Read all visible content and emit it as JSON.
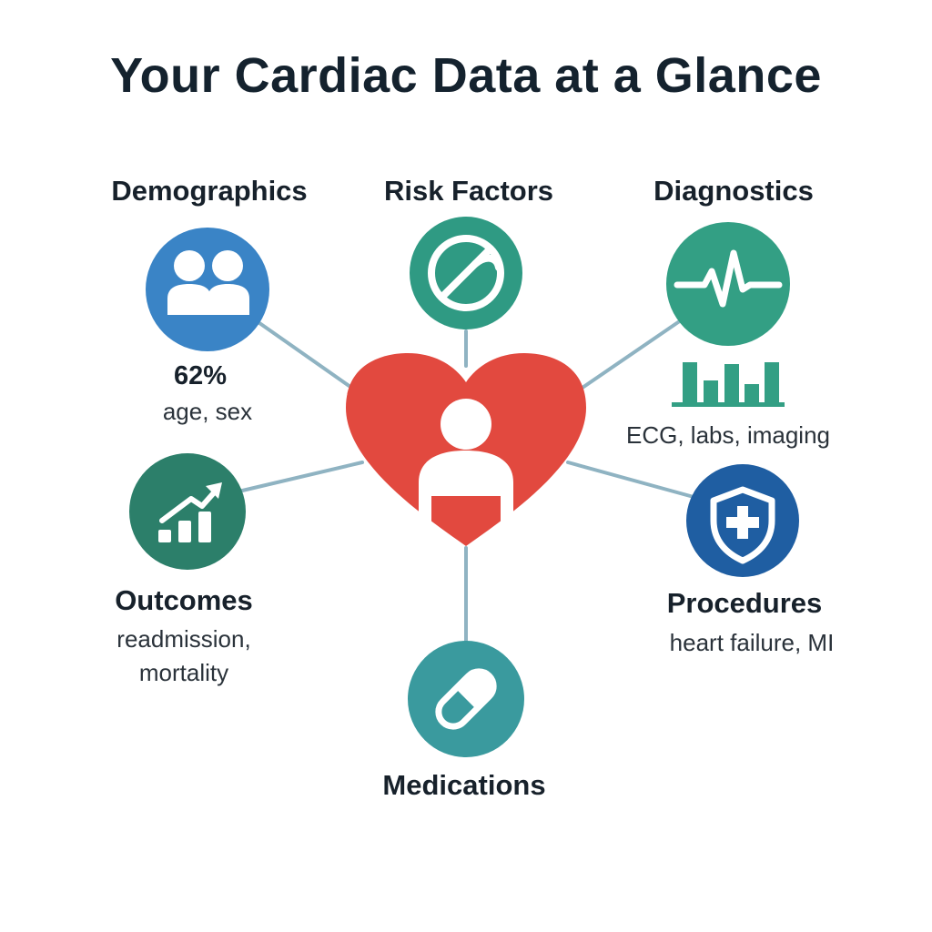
{
  "title": "Your Cardiac Data at a Glance",
  "nodes": {
    "demographics": {
      "label": "Demographics",
      "stat": "62%",
      "detail": "age, sex",
      "color": "#3a84c6",
      "icon": "people-icon"
    },
    "risk_factors": {
      "label": "Risk Factors",
      "color": "#2f9a83",
      "icon": "no-smoking-icon"
    },
    "diagnostics": {
      "label": "Diagnostics",
      "detail": "ECG, labs, imaging",
      "color": "#339f84",
      "icon": "ecg-wave-icon",
      "chart_icon": "bar-chart-icon"
    },
    "outcomes": {
      "label": "Outcomes",
      "detail_lines": [
        "readmission,",
        "mortality"
      ],
      "color": "#2c7f6a",
      "icon": "trend-up-icon"
    },
    "procedures": {
      "label": "Procedures",
      "detail": "heart failure, MI",
      "color": "#1f5ea2",
      "icon": "shield-plus-icon"
    },
    "medications": {
      "label": "Medications",
      "color": "#3a9a9e",
      "icon": "pill-icon"
    }
  },
  "center": {
    "color": "#e2493f",
    "icon": "heart-person-icon"
  },
  "connector_color": "#8fb3c2"
}
